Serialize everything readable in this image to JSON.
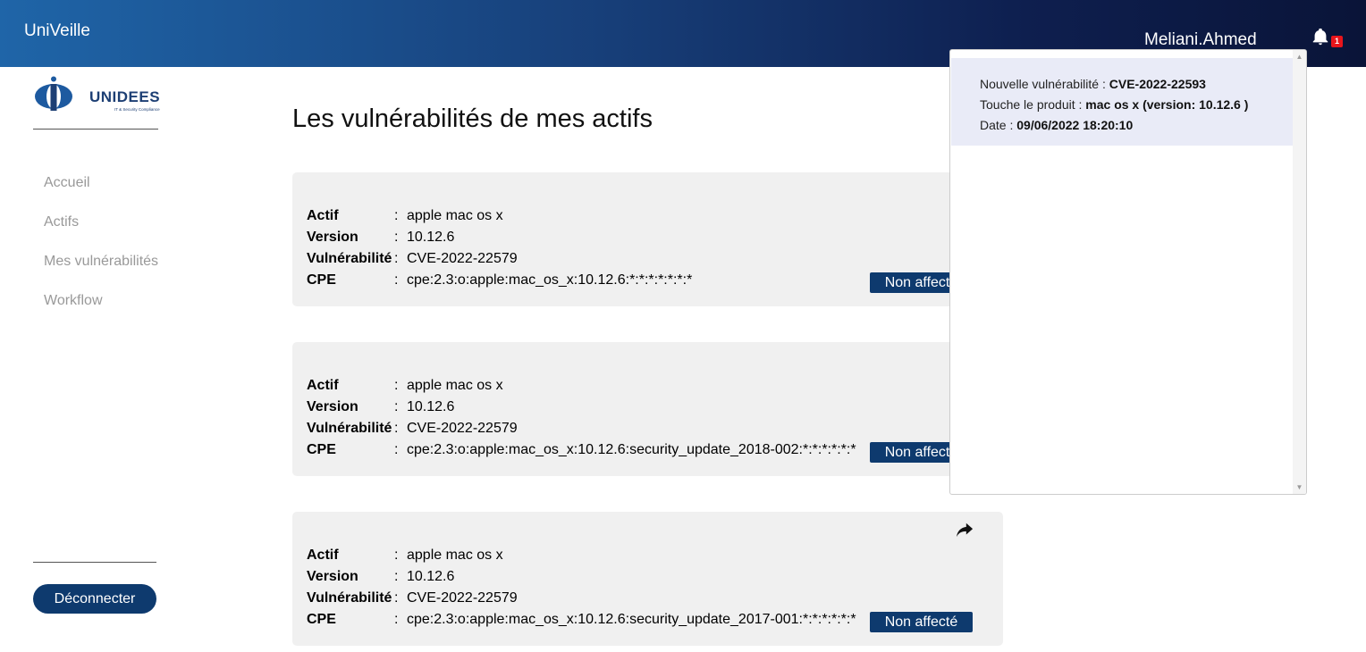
{
  "header": {
    "brand": "UniVeille",
    "username": "Meliani.Ahmed",
    "notification_count": "1"
  },
  "sidebar": {
    "logo_text": "UNIDEES",
    "logo_subtitle": "IT & Security Compliance",
    "items": [
      {
        "label": "Accueil"
      },
      {
        "label": "Actifs"
      },
      {
        "label": "Mes vulnérabilités"
      },
      {
        "label": "Workflow"
      }
    ],
    "logout_label": "Déconnecter"
  },
  "main": {
    "title": "Les vulnérabilités de mes actifs",
    "field_labels": {
      "actif": "Actif",
      "version": "Version",
      "vulnerabilite": "Vulnérabilité",
      "cpe": "CPE",
      "separator": ":"
    },
    "cards": [
      {
        "actif": "apple mac os x",
        "version": "10.12.6",
        "vulnerabilite": "CVE-2022-22579",
        "cpe": "cpe:2.3:o:apple:mac_os_x:10.12.6:*:*:*:*:*:*:*",
        "status": "Non affecté"
      },
      {
        "actif": "apple mac os x",
        "version": "10.12.6",
        "vulnerabilite": "CVE-2022-22579",
        "cpe": "cpe:2.3:o:apple:mac_os_x:10.12.6:security_update_2018-002:*:*:*:*:*:*",
        "status": "Non affecté"
      },
      {
        "actif": "apple mac os x",
        "version": "10.12.6",
        "vulnerabilite": "CVE-2022-22579",
        "cpe": "cpe:2.3:o:apple:mac_os_x:10.12.6:security_update_2017-001:*:*:*:*:*:*",
        "status": "Non affecté"
      }
    ]
  },
  "notifications": {
    "items": [
      {
        "label_vuln": "Nouvelle vulnérabilité : ",
        "cve": "CVE-2022-22593",
        "label_product": "Touche le produit : ",
        "product": "mac os x (version: 10.12.6 )",
        "label_date": "Date : ",
        "date": "09/06/2022 18:20:10"
      }
    ]
  },
  "colors": {
    "header_start": "#1f65a8",
    "header_end": "#0a1438",
    "primary_button": "#0e3a6e",
    "badge": "#e8151b",
    "notif_highlight": "#e9ebf7"
  },
  "icons": {
    "bell": "bell-icon",
    "share": "share-arrow-icon"
  }
}
